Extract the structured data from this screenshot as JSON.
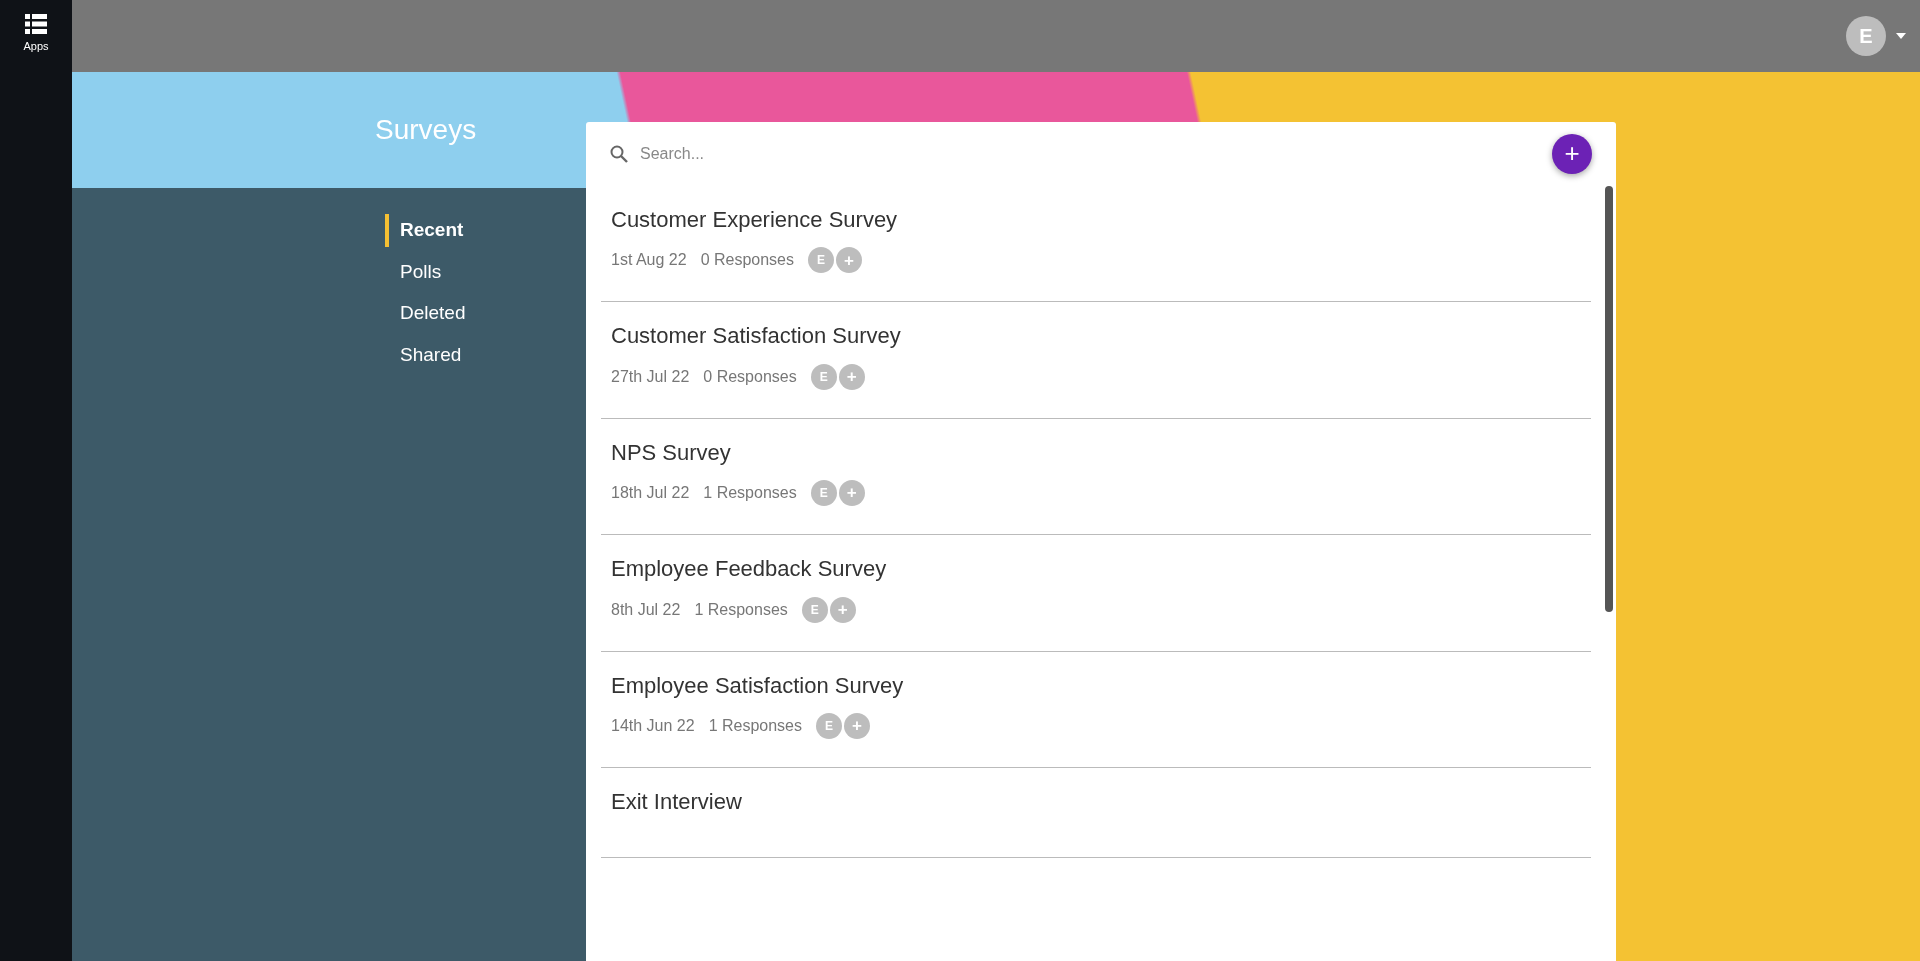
{
  "rail": {
    "apps_label": "Apps"
  },
  "topbar": {
    "user_initial": "E"
  },
  "title": "Surveys",
  "nav": [
    {
      "label": "Recent",
      "selected": true
    },
    {
      "label": "Polls",
      "selected": false
    },
    {
      "label": "Deleted",
      "selected": false
    },
    {
      "label": "Shared",
      "selected": false
    }
  ],
  "search": {
    "placeholder": "Search..."
  },
  "add_button": "+",
  "surveys": [
    {
      "title": "Customer Experience Survey",
      "date": "1st Aug 22",
      "responses": "0 Responses",
      "collaborators": [
        "E"
      ],
      "add_collaborator": "+"
    },
    {
      "title": "Customer Satisfaction Survey",
      "date": "27th Jul 22",
      "responses": "0 Responses",
      "collaborators": [
        "E"
      ],
      "add_collaborator": "+"
    },
    {
      "title": "NPS Survey",
      "date": "18th Jul 22",
      "responses": "1 Responses",
      "collaborators": [
        "E"
      ],
      "add_collaborator": "+"
    },
    {
      "title": "Employee Feedback Survey",
      "date": "8th Jul 22",
      "responses": "1 Responses",
      "collaborators": [
        "E"
      ],
      "add_collaborator": "+"
    },
    {
      "title": "Employee Satisfaction Survey",
      "date": "14th Jun 22",
      "responses": "1 Responses",
      "collaborators": [
        "E"
      ],
      "add_collaborator": "+"
    },
    {
      "title": "Exit Interview"
    }
  ]
}
